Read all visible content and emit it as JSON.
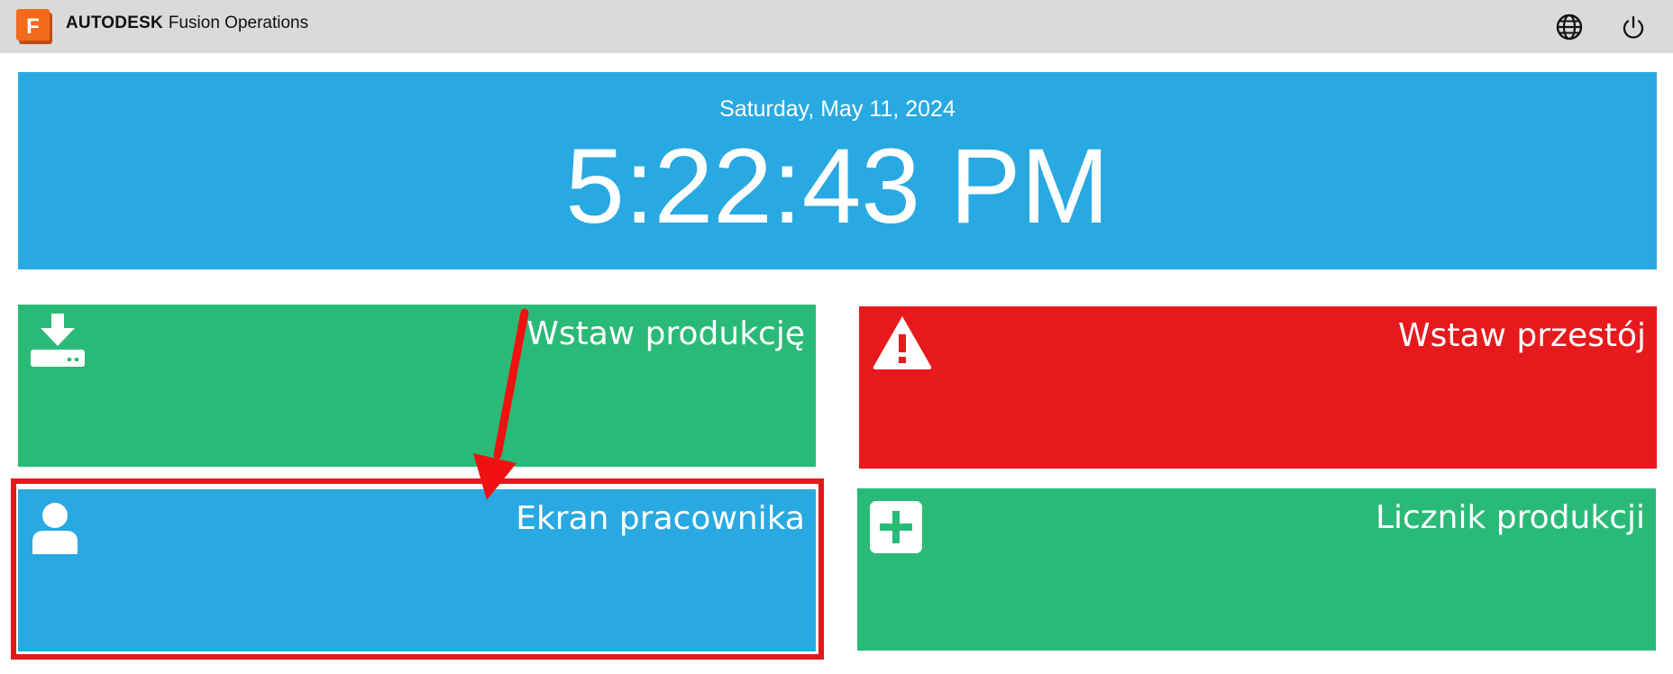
{
  "header": {
    "brand_bold": "AUTODESK",
    "brand_product": "Fusion Operations",
    "logo_letter": "F",
    "icons": [
      "globe-icon",
      "power-icon"
    ]
  },
  "clock": {
    "date": "Saturday, May 11, 2024",
    "time": "5:22:43 PM"
  },
  "tiles": [
    {
      "label": "Wstaw produkcję",
      "icon": "download-tray-icon",
      "color": "#2aba77"
    },
    {
      "label": "Wstaw przestój",
      "icon": "warning-icon",
      "color": "#e8191c"
    },
    {
      "label": "Ekran pracownika",
      "icon": "user-icon",
      "color": "#29a9e2"
    },
    {
      "label": "Licznik produkcji",
      "icon": "plus-square-icon",
      "color": "#2aba77"
    }
  ],
  "colors": {
    "topbar": "#dadada",
    "clock_panel": "#29a9e2",
    "annotation": "#e11a1a",
    "logo_orange": "#f26b1d"
  }
}
